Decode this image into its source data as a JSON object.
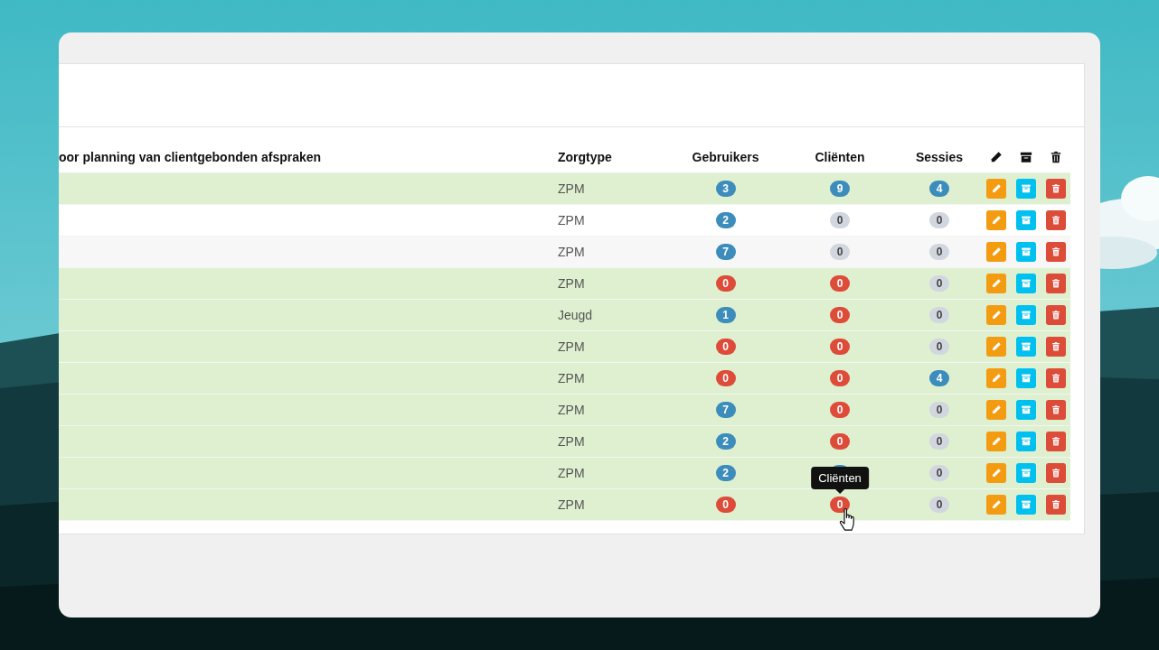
{
  "table": {
    "columns": [
      "oor planning van clientgebonden afspraken",
      "Zorgtype",
      "Gebruikers",
      "Cliënten",
      "Sessies"
    ],
    "rows": [
      {
        "highlighted": true,
        "zorgtype": "ZPM",
        "gebruikers": {
          "value": "3",
          "color": "#3c8dbc"
        },
        "clienten": {
          "value": "9",
          "color": "#3c8dbc"
        },
        "sessies": {
          "value": "4",
          "color": "#3c8dbc"
        }
      },
      {
        "highlighted": false,
        "zorgtype": "ZPM",
        "gebruikers": {
          "value": "2",
          "color": "#3c8dbc"
        },
        "clienten": {
          "value": "0",
          "color": "#d2d6de"
        },
        "sessies": {
          "value": "0",
          "color": "#d2d6de"
        }
      },
      {
        "highlighted": false,
        "zorgtype": "ZPM",
        "gebruikers": {
          "value": "7",
          "color": "#3c8dbc"
        },
        "clienten": {
          "value": "0",
          "color": "#d2d6de"
        },
        "sessies": {
          "value": "0",
          "color": "#d2d6de"
        }
      },
      {
        "highlighted": true,
        "zorgtype": "ZPM",
        "gebruikers": {
          "value": "0",
          "color": "#dd4b39"
        },
        "clienten": {
          "value": "0",
          "color": "#dd4b39"
        },
        "sessies": {
          "value": "0",
          "color": "#d2d6de"
        }
      },
      {
        "highlighted": true,
        "zorgtype": "Jeugd",
        "gebruikers": {
          "value": "1",
          "color": "#3c8dbc"
        },
        "clienten": {
          "value": "0",
          "color": "#dd4b39"
        },
        "sessies": {
          "value": "0",
          "color": "#d2d6de"
        }
      },
      {
        "highlighted": true,
        "zorgtype": "ZPM",
        "gebruikers": {
          "value": "0",
          "color": "#dd4b39"
        },
        "clienten": {
          "value": "0",
          "color": "#dd4b39"
        },
        "sessies": {
          "value": "0",
          "color": "#d2d6de"
        }
      },
      {
        "highlighted": true,
        "zorgtype": "ZPM",
        "gebruikers": {
          "value": "0",
          "color": "#dd4b39"
        },
        "clienten": {
          "value": "0",
          "color": "#dd4b39"
        },
        "sessies": {
          "value": "4",
          "color": "#3c8dbc"
        }
      },
      {
        "highlighted": true,
        "zorgtype": "ZPM",
        "gebruikers": {
          "value": "7",
          "color": "#3c8dbc"
        },
        "clienten": {
          "value": "0",
          "color": "#dd4b39"
        },
        "sessies": {
          "value": "0",
          "color": "#d2d6de"
        }
      },
      {
        "highlighted": true,
        "zorgtype": "ZPM",
        "gebruikers": {
          "value": "2",
          "color": "#3c8dbc"
        },
        "clienten": {
          "value": "0",
          "color": "#dd4b39"
        },
        "sessies": {
          "value": "0",
          "color": "#d2d6de"
        }
      },
      {
        "highlighted": true,
        "zorgtype": "ZPM",
        "gebruikers": {
          "value": "2",
          "color": "#3c8dbc"
        },
        "clienten": {
          "color": "#3c8dbc",
          "tooltip": "Cliënten"
        },
        "sessies": {
          "value": "0",
          "color": "#d2d6de"
        }
      },
      {
        "highlighted": true,
        "zorgtype": "ZPM",
        "gebruikers": {
          "value": "0",
          "color": "#dd4b39"
        },
        "clienten": {
          "value": "0",
          "color": "#dd4b39",
          "pointer": true
        },
        "sessies": {
          "value": "0",
          "color": "#d2d6de"
        }
      }
    ]
  }
}
